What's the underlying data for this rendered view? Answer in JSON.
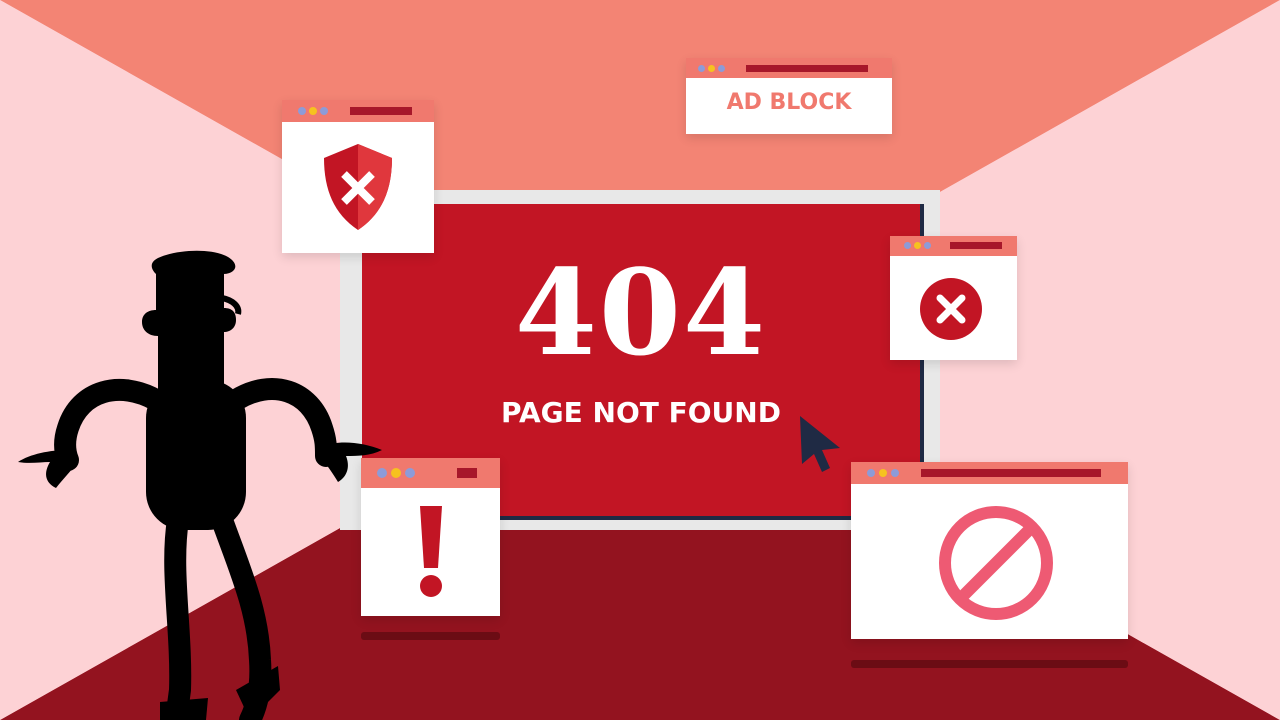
{
  "screen": {
    "code": "404",
    "message": "PAGE NOT FOUND"
  },
  "popups": {
    "ad_block": {
      "label": "AD BLOCK"
    }
  },
  "icons": {
    "shield": "shield-x-icon",
    "error": "x-circle-icon",
    "warning": "exclamation-icon",
    "blocked": "no-entry-icon",
    "cursor": "cursor-arrow-icon"
  },
  "colors": {
    "screen_red": "#c21524",
    "floor": "#93131f",
    "ceiling": "#f38474",
    "walls": "#fbd5d8",
    "popup_bar": "#f0796e",
    "accent_pink": "#ee5a73"
  }
}
